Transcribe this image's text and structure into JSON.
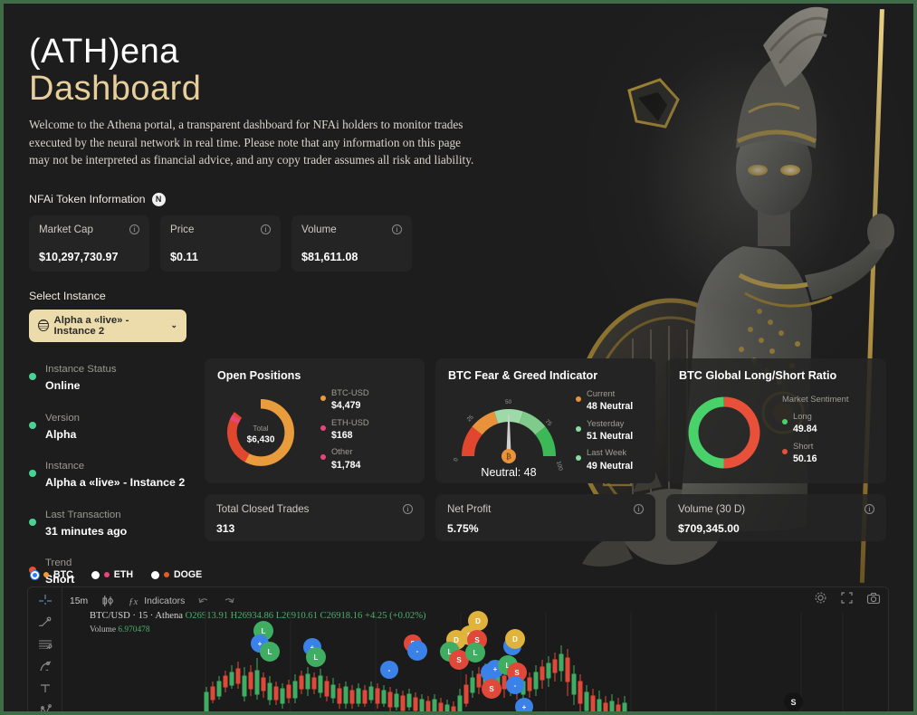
{
  "brand": {
    "title_line1": "(ATH)ena",
    "title_line2": "Dashboard",
    "intro": "Welcome to the Athena portal, a transparent dashboard for NFAi holders to monitor trades executed by the neural network in real time. Please note that any information on this page may not be interpreted as financial advice, and any copy trader assumes all risk and liability."
  },
  "token_section": {
    "label": "NFAi Token Information",
    "badge": "N",
    "cards": [
      {
        "name": "Market Cap",
        "value": "$10,297,730.97",
        "info": "i"
      },
      {
        "name": "Price",
        "value": "$0.11",
        "info": "i"
      },
      {
        "name": "Volume",
        "value": "$81,611.08",
        "info": "i"
      }
    ]
  },
  "instance_select": {
    "label": "Select Instance",
    "value": "Alpha a «live» - Instance 2",
    "chevron": "⌄",
    "icon": "globe-icon"
  },
  "status": {
    "items": [
      {
        "key": "Instance Status",
        "value": "Online",
        "color": "#4ad295"
      },
      {
        "key": "Version",
        "value": "Alpha",
        "color": "#4ad295"
      },
      {
        "key": "Instance",
        "value": "Alpha a «live» - Instance 2",
        "color": "#4ad295"
      },
      {
        "key": "Last Transaction",
        "value": "31 minutes ago",
        "color": "#4ad295"
      },
      {
        "key": "Trend",
        "value": "Short",
        "color": "#e8503a"
      }
    ]
  },
  "open_positions": {
    "title": "Open Positions",
    "center_label": "Total",
    "center_value": "$6,430",
    "legend": [
      {
        "name": "BTC-USD",
        "value": "$4,479",
        "color": "#e89c3c"
      },
      {
        "name": "ETH-USD",
        "value": "$168",
        "color": "#e8457a"
      },
      {
        "name": "Other",
        "value": "$1,784",
        "color": "#e8457a"
      }
    ]
  },
  "fear_greed": {
    "title": "BTC Fear & Greed Indicator",
    "gauge_label": "Neutral: 48",
    "ticks": [
      "0",
      "25",
      "50",
      "75",
      "100"
    ],
    "legend": [
      {
        "name": "Current",
        "value": "48 Neutral",
        "color": "#e8923c"
      },
      {
        "name": "Yesterday",
        "value": "51 Neutral",
        "color": "#8fd89f"
      },
      {
        "name": "Last Week",
        "value": "49 Neutral",
        "color": "#8fd89f"
      }
    ]
  },
  "long_short": {
    "title": "BTC Global Long/Short Ratio",
    "sentiment_label": "Market Sentiment",
    "legend": [
      {
        "name": "Long",
        "value": "49.84",
        "color": "#4ad26a"
      },
      {
        "name": "Short",
        "value": "50.16",
        "color": "#e8503a"
      }
    ]
  },
  "stats": [
    {
      "name": "Total Closed Trades",
      "value": "313",
      "info": "i"
    },
    {
      "name": "Net Profit",
      "value": "5.75%",
      "info": "i"
    },
    {
      "name": "Volume (30 D)",
      "value": "$709,345.00",
      "info": "i"
    }
  ],
  "chart_legend": [
    {
      "label": "BTC",
      "selected": true,
      "color": "#e89c3c"
    },
    {
      "label": "ETH",
      "selected": false,
      "color": "#e8457a"
    },
    {
      "label": "DOGE",
      "selected": false,
      "color": "#e05c2a"
    }
  ],
  "trading_view": {
    "timeframe": "15m",
    "indicators_label": "Indicators",
    "symbol_line": "BTC/USD · 15 · Athena",
    "ohlc": "O26913.91  H26934.86  L26910.61  C26918.16  +4.25 (+0.02%)",
    "volume_label": "Volume",
    "volume_value": "6.970478",
    "marker_badge": "S",
    "tools": [
      "crosshair-icon",
      "trend-line-icon",
      "horizontal-lines-icon",
      "brush-icon",
      "text-icon",
      "pattern-icon"
    ],
    "right_icons": [
      "gear-icon",
      "fullscreen-icon",
      "camera-icon"
    ]
  },
  "chart_data": {
    "type": "candlestick",
    "title": "BTC/USD · 15 · Athena",
    "ohlc": {
      "open": 26913.91,
      "high": 26934.86,
      "low": 26910.61,
      "close": 26918.16,
      "change": 4.25,
      "change_pct": 0.02
    },
    "volume": 6.970478,
    "donut_open_positions": {
      "type": "pie",
      "labels": [
        "BTC-USD",
        "Other",
        "ETH-USD"
      ],
      "values": [
        4479,
        1784,
        168
      ],
      "total": 6430
    },
    "gauge_fear_greed": {
      "type": "gauge",
      "value": 48,
      "min": 0,
      "max": 100,
      "label": "Neutral",
      "history": {
        "current": 48,
        "yesterday": 51,
        "last_week": 49
      }
    },
    "donut_long_short": {
      "type": "pie",
      "labels": [
        "Long",
        "Short"
      ],
      "values": [
        49.84,
        50.16
      ]
    }
  }
}
